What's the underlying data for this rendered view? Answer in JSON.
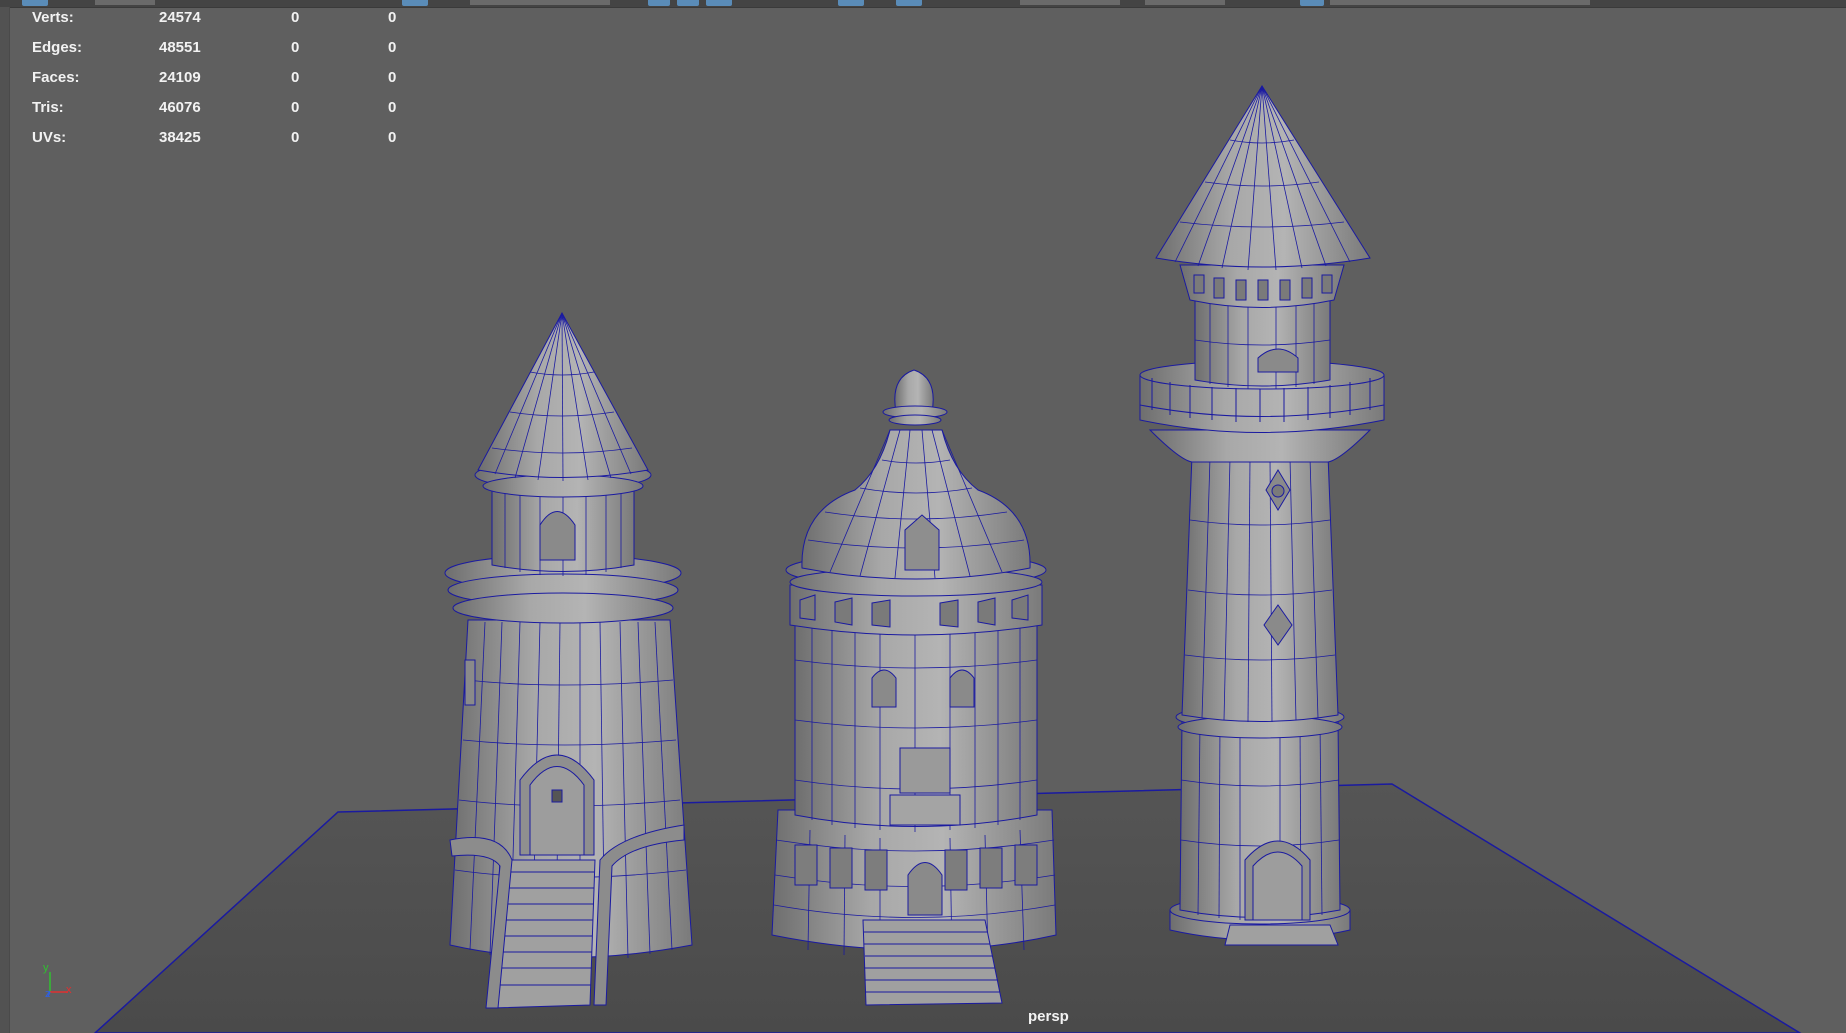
{
  "hud": {
    "rows": [
      {
        "label": "Verts:",
        "v1": "24574",
        "v2": "0",
        "v3": "0"
      },
      {
        "label": "Edges:",
        "v1": "48551",
        "v2": "0",
        "v3": "0"
      },
      {
        "label": "Faces:",
        "v1": "24109",
        "v2": "0",
        "v3": "0"
      },
      {
        "label": "Tris:",
        "v1": "46076",
        "v2": "0",
        "v3": "0"
      },
      {
        "label": "UVs:",
        "v1": "38425",
        "v2": "0",
        "v3": "0"
      }
    ]
  },
  "camera": {
    "name": "persp"
  },
  "axis": {
    "y": "y",
    "z": "z",
    "x": "x"
  },
  "colors": {
    "background": "#5f5f5f",
    "wireframe": "#1a1aa0",
    "model_fill": "#9a9a9a",
    "ground": "#4e4e4e",
    "axis_x": "#e03030",
    "axis_y": "#30c030",
    "axis_z": "#3060e0"
  }
}
